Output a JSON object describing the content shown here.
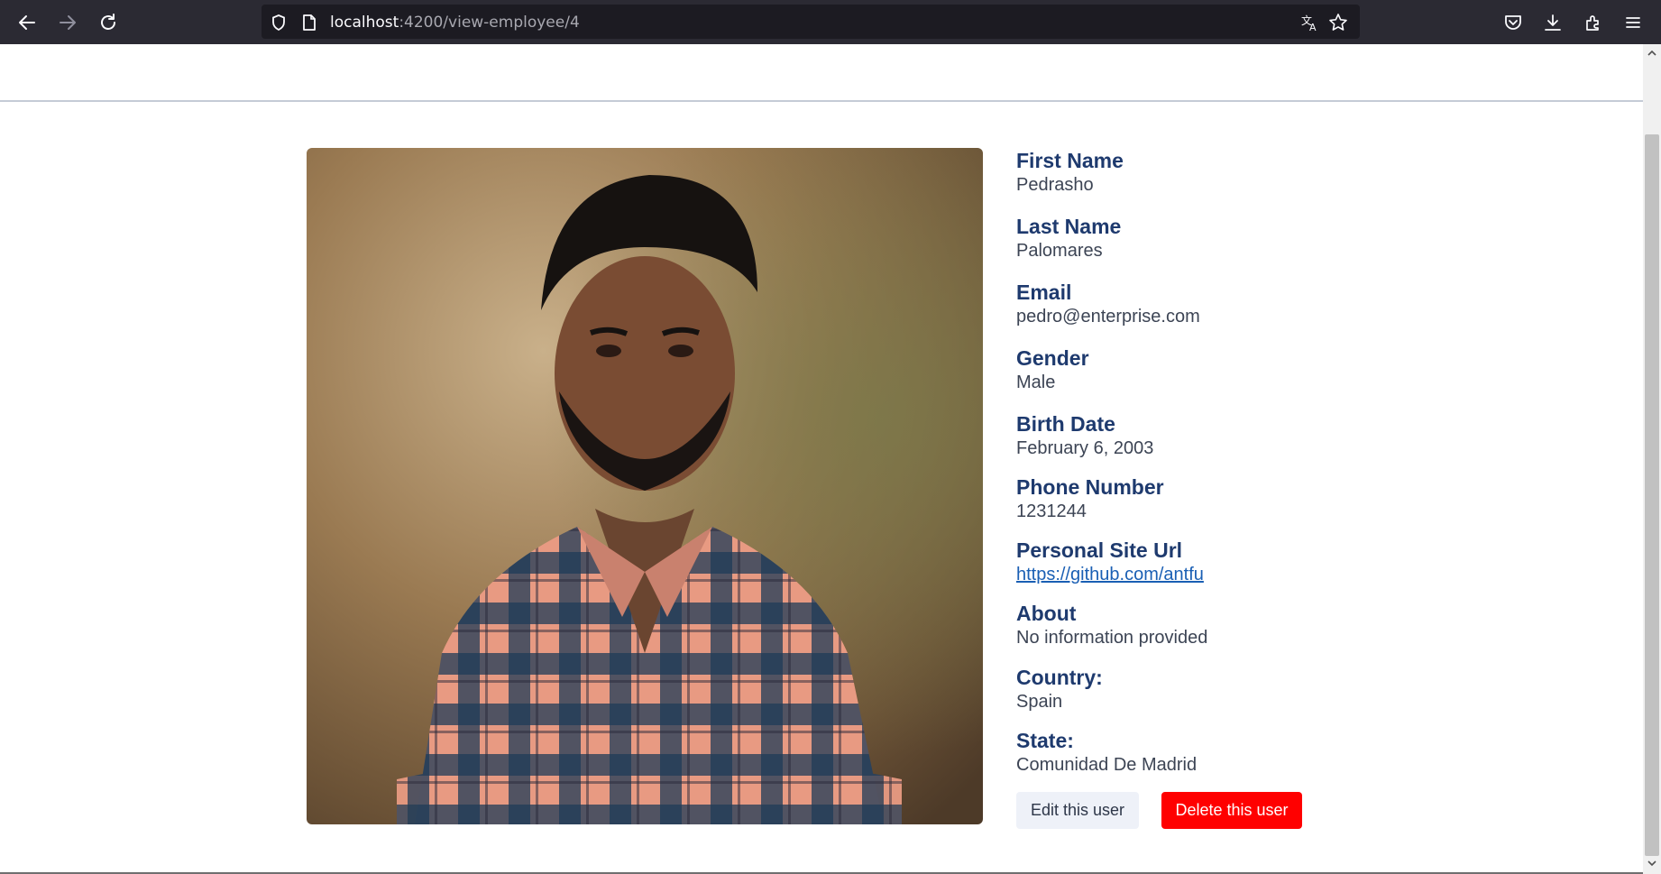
{
  "browser": {
    "url_host": "localhost",
    "url_path": ":4200/view-employee/4"
  },
  "employee": {
    "fields": [
      {
        "label": "First Name",
        "value": "Pedrasho"
      },
      {
        "label": "Last Name",
        "value": "Palomares"
      },
      {
        "label": "Email",
        "value": "pedro@enterprise.com"
      },
      {
        "label": "Gender",
        "value": "Male"
      },
      {
        "label": "Birth Date",
        "value": "February 6, 2003"
      },
      {
        "label": "Phone Number",
        "value": "1231244"
      },
      {
        "label": "Personal Site Url",
        "value": "https://github.com/antfu"
      },
      {
        "label": "About",
        "value": "No information provided"
      },
      {
        "label": "Country:",
        "value": "Spain"
      },
      {
        "label": "State:",
        "value": "Comunidad De Madrid"
      }
    ]
  },
  "actions": {
    "edit_label": "Edit this user",
    "delete_label": "Delete this user"
  },
  "colors": {
    "label": "#1e3a6e",
    "value": "#3c4454",
    "link": "#1a5fb4",
    "delete_button": "#ff0000",
    "edit_button": "#eef1f8"
  }
}
